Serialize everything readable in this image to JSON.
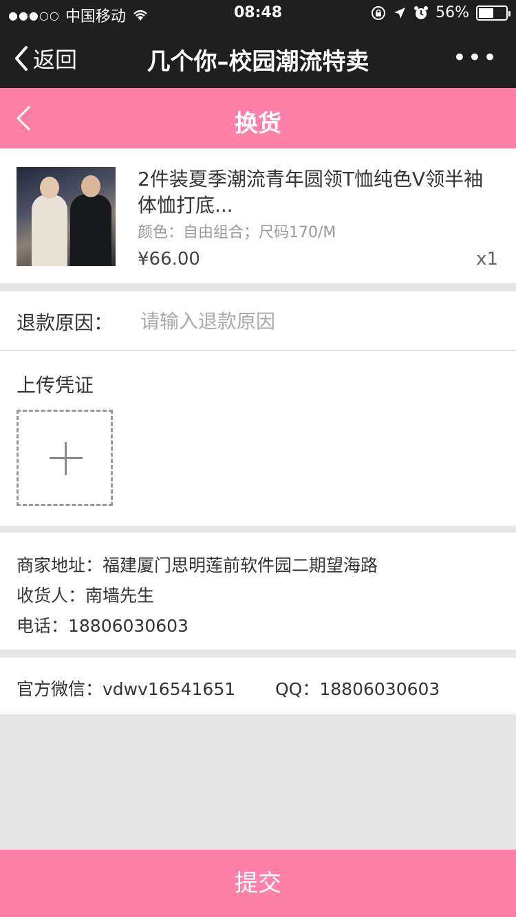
{
  "status_bar": {
    "signal": "●●●○○",
    "carrier": "中国移动",
    "time": "08:48",
    "battery": "56%",
    "battery_level": 0.56
  },
  "nav": {
    "back_label": "返回",
    "title": "几个你–校园潮流特卖",
    "more": "•••"
  },
  "page": {
    "title": "换货"
  },
  "product": {
    "title": "2件装夏季潮流青年圆领T恤纯色V领半袖体恤打底...",
    "spec": "颜色：自由组合；尺码170/M",
    "price": "¥66.00",
    "qty": "x1"
  },
  "reason": {
    "label": "退款原因：",
    "placeholder": "请输入退款原因",
    "value": ""
  },
  "upload": {
    "label": "上传凭证"
  },
  "merchant": {
    "address": "商家地址：福建厦门思明莲前软件园二期望海路",
    "receiver": "收货人：南墙先生",
    "phone": "电话：18806030603"
  },
  "contact": {
    "wechat": "官方微信：vdwv16541651",
    "qq": "QQ：18806030603"
  },
  "submit_label": "提交",
  "colors": {
    "accent": "#ff80a8",
    "dark": "#1f1f1f",
    "bg": "#e7e7e7"
  },
  "icons": [
    "signal-dots-icon",
    "wifi-icon",
    "lock-rotation-icon",
    "location-arrow-icon",
    "alarm-icon",
    "battery-icon",
    "back-chevron-icon",
    "more-icon",
    "product-thumbnail",
    "add-photo-icon"
  ]
}
